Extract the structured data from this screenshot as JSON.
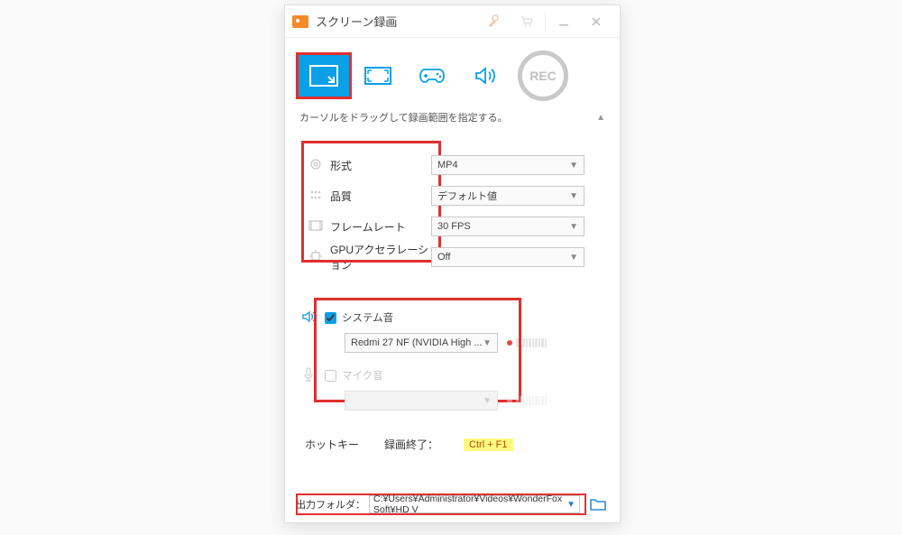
{
  "titlebar": {
    "title": "スクリーン録画"
  },
  "modes": {
    "rec_label": "REC"
  },
  "hint": {
    "text": "カーソルをドラッグして録画範囲を指定する。"
  },
  "settings": {
    "rows": [
      {
        "label": "形式",
        "value": "MP4"
      },
      {
        "label": "品質",
        "value": "デフォルト値"
      },
      {
        "label": "フレームレート",
        "value": "30 FPS"
      },
      {
        "label": "GPUアクセラレーション",
        "value": "Off"
      }
    ]
  },
  "audio": {
    "system": {
      "label": "システム音",
      "checked": true,
      "device": "Redmi 27 NF (NVIDIA High ..."
    },
    "mic": {
      "label": "マイク音",
      "checked": false,
      "device": ""
    }
  },
  "hotkey": {
    "label": "ホットキー",
    "stop_label": "録画終了：",
    "stop_key": "Ctrl + F1"
  },
  "output": {
    "label": "出力フォルダ：",
    "path": "C:¥Users¥Administrator¥Videos¥WonderFox Soft¥HD V"
  }
}
